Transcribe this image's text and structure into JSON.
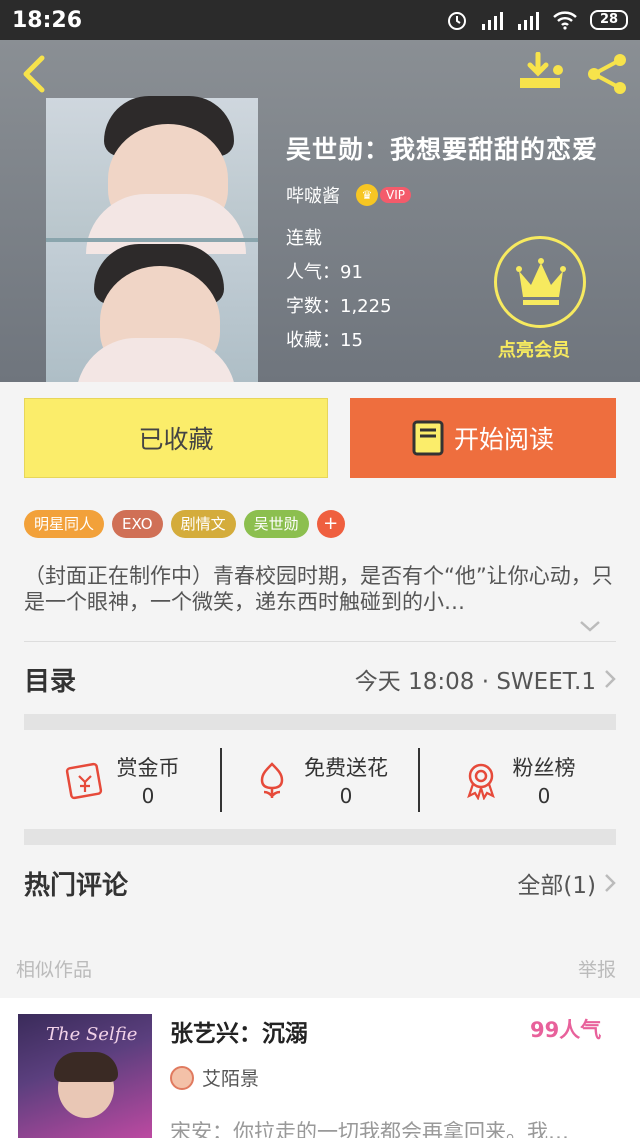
{
  "status_bar": {
    "time": "18:26",
    "battery": "28"
  },
  "book": {
    "title": "吴世勋：我想要甜甜的恋爱",
    "author": "哔啵酱",
    "vip_label": "VIP",
    "status": "连载",
    "popularity": "人气：91",
    "word_count": "字数：1,225",
    "favorites": "收藏：15",
    "member_label": "点亮会员"
  },
  "actions": {
    "favorited_label": "已收藏",
    "read_label": "开始阅读"
  },
  "tags": [
    {
      "label": "明星同人",
      "color": "#f2a13a"
    },
    {
      "label": "EXO",
      "color": "#d07056"
    },
    {
      "label": "剧情文",
      "color": "#d4ac3b"
    },
    {
      "label": "吴世勋",
      "color": "#8cbf4f"
    }
  ],
  "tag_add": "+",
  "description": "（封面正在制作中）青春校园时期，是否有个“他”让你心动，只是一个眼神，一个微笑，递东西时触碰到的小…",
  "catalog": {
    "label": "目录",
    "latest": "今天 18:08 · SWEET.1"
  },
  "stats": [
    {
      "name": "赏金币",
      "value": "0",
      "icon": "red-envelope-icon"
    },
    {
      "name": "免费送花",
      "value": "0",
      "icon": "flower-icon"
    },
    {
      "name": "粉丝榜",
      "value": "0",
      "icon": "ribbon-icon"
    }
  ],
  "comments": {
    "label": "热门评论",
    "all": "全部(1)"
  },
  "similar": {
    "label": "相似作品",
    "report": "举报"
  },
  "similar_card": {
    "title": "张艺兴：沉溺",
    "popularity": "99人气",
    "author": "艾陌景",
    "cover_text": "The Selfie",
    "desc": "宋安：你拉走的一切我都会再拿回来。我…"
  },
  "colors": {
    "accent_yellow": "#fbed6a",
    "accent_orange": "#ee6e3e",
    "pink": "#e8619b"
  }
}
